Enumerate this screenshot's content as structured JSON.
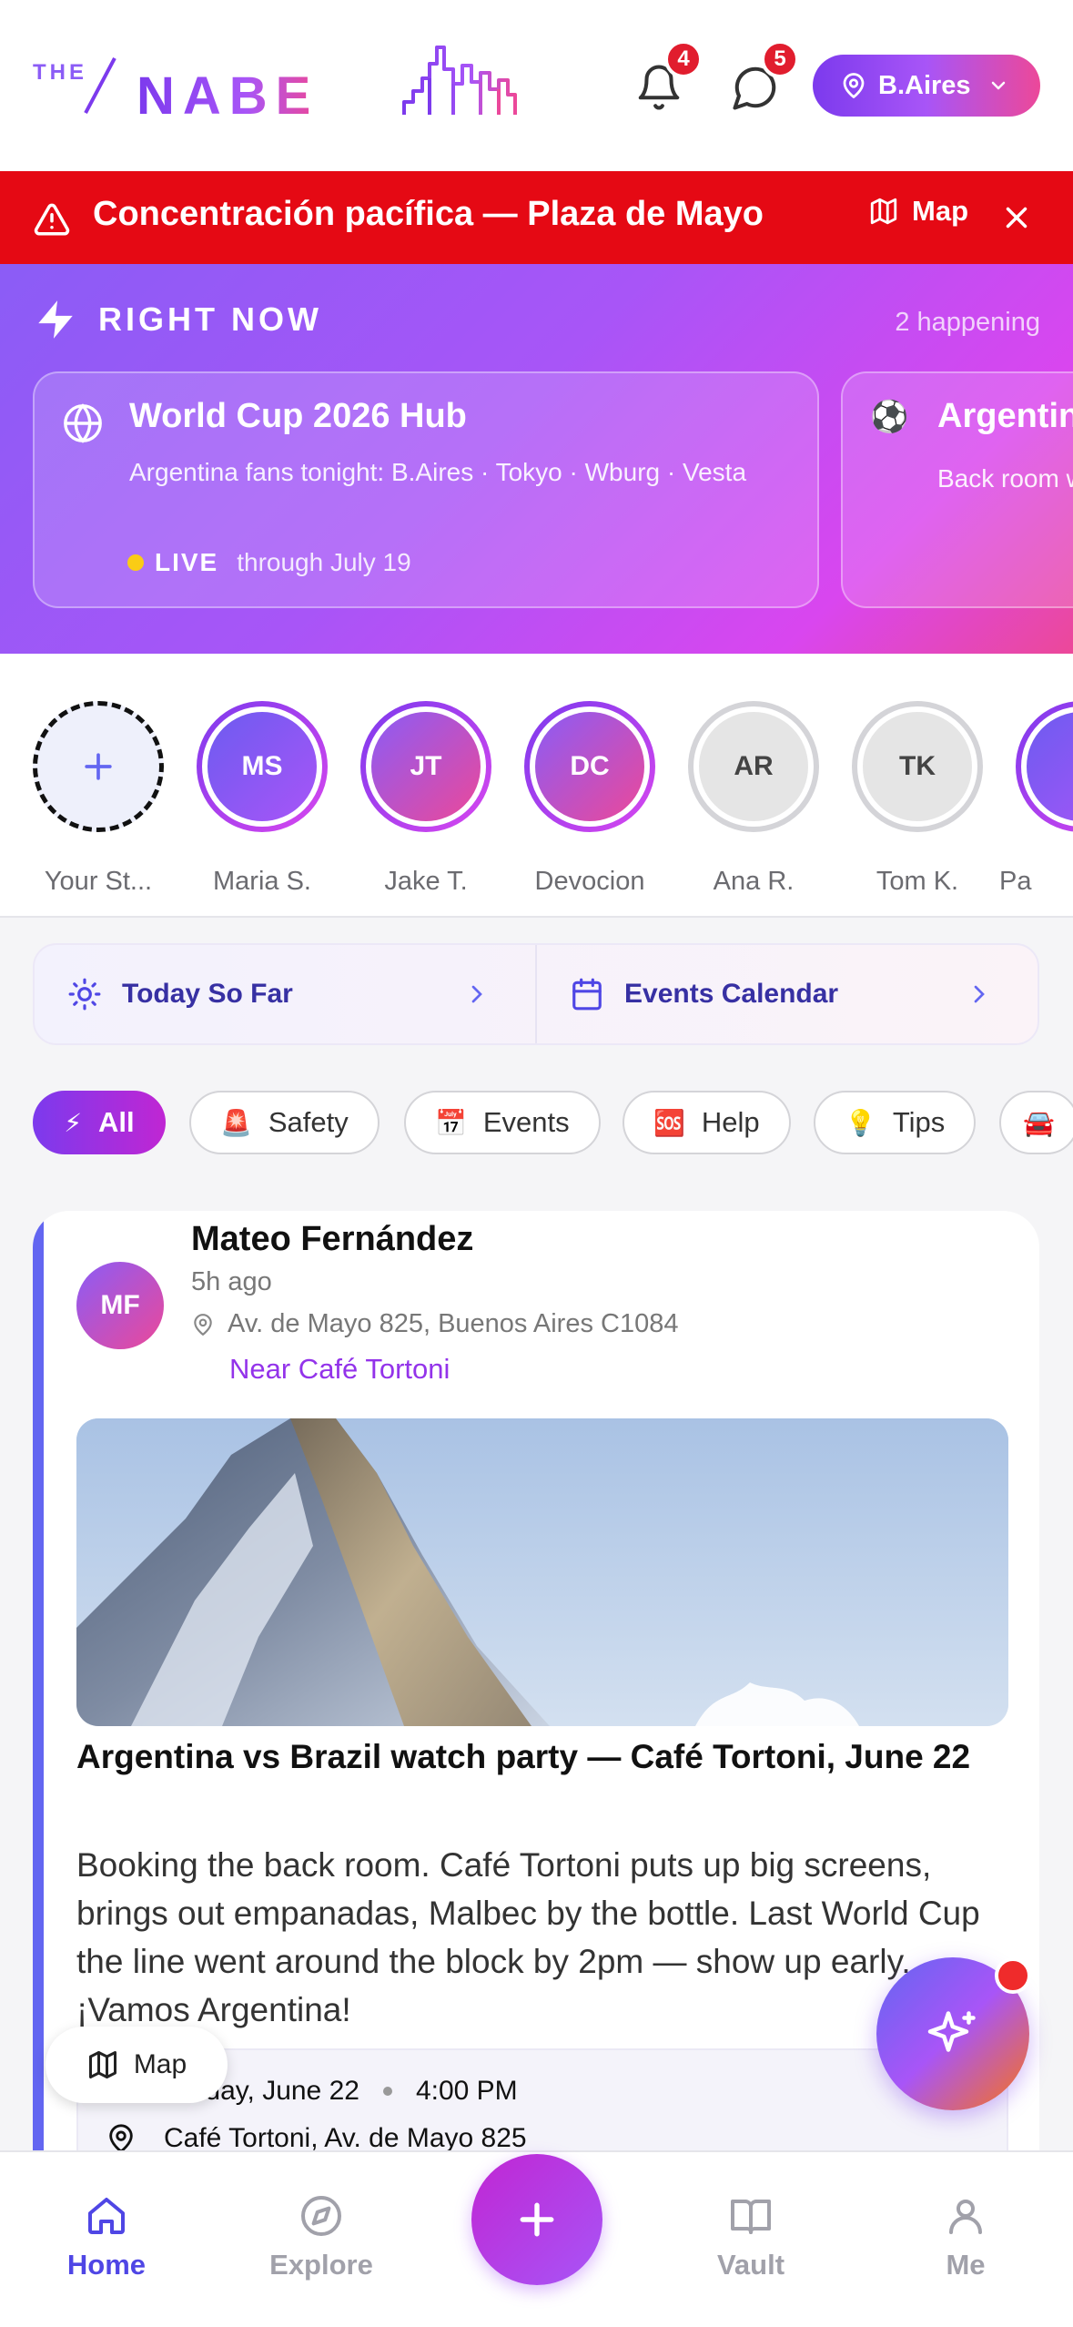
{
  "header": {
    "logo_prefix": "THE",
    "logo_name": "NABE",
    "notifications_count": "4",
    "messages_count": "5",
    "city": "B.Aires"
  },
  "alert": {
    "text": "Concentración pacífica — Plaza de Mayo",
    "map_label": "Map"
  },
  "right_now": {
    "title": "RIGHT NOW",
    "count_label": "2 happening",
    "cards": [
      {
        "icon": "globe-icon",
        "title": "World Cup 2026 Hub",
        "description": "Argentina fans tonight: B.Aires · Tokyo · Wburg · Vesta",
        "live_label": "LIVE",
        "live_when": "through July 19"
      },
      {
        "icon": "soccer-ball-icon",
        "title": "Argentin",
        "description": "Back room wraps the"
      }
    ]
  },
  "stories": [
    {
      "name": "Your St...",
      "initials": "",
      "type": "add"
    },
    {
      "name": "Maria S.",
      "initials": "MS",
      "type": "active"
    },
    {
      "name": "Jake T.",
      "initials": "JT",
      "type": "active"
    },
    {
      "name": "Devocion",
      "initials": "DC",
      "type": "active"
    },
    {
      "name": "Ana R.",
      "initials": "AR",
      "type": "seen"
    },
    {
      "name": "Tom K.",
      "initials": "TK",
      "type": "seen"
    },
    {
      "name": "Pa",
      "initials": "",
      "type": "active"
    }
  ],
  "quick_links": [
    {
      "label": "Today So Far",
      "icon": "sun-icon"
    },
    {
      "label": "Events Calendar",
      "icon": "calendar-icon"
    }
  ],
  "filters": [
    {
      "label": "All",
      "emoji": "⚡",
      "active": true
    },
    {
      "label": "Safety",
      "emoji": "🚨"
    },
    {
      "label": "Events",
      "emoji": "📅"
    },
    {
      "label": "Help",
      "emoji": "🆘"
    },
    {
      "label": "Tips",
      "emoji": "💡"
    },
    {
      "label": "",
      "emoji": "🚘"
    }
  ],
  "post": {
    "author": "Mateo Fernández",
    "initials": "MF",
    "time": "5h ago",
    "address": "Av. de Mayo 825, Buenos Aires C1084",
    "near": "Near Café Tortoni",
    "headline": "Argentina vs Brazil watch party — Café Tortoni, June 22",
    "body": "Booking the back room. Café Tortoni puts up big screens, brings out empanadas, Malbec by the bottle. Last World Cup the line went around the block by 2pm — show up early. ¡Vamos Argentina!",
    "event_date": "Sunday, June 22",
    "event_time": "4:00 PM",
    "event_place": "Café Tortoni, Av. de Mayo 825"
  },
  "floating": {
    "map_label": "Map"
  },
  "nav": {
    "home": "Home",
    "explore": "Explore",
    "vault": "Vault",
    "me": "Me"
  },
  "colors": {
    "brand_purple": "#7c3aed",
    "brand_pink": "#ec4899",
    "alert_red": "#e50914",
    "nav_active": "#4f46e5"
  }
}
